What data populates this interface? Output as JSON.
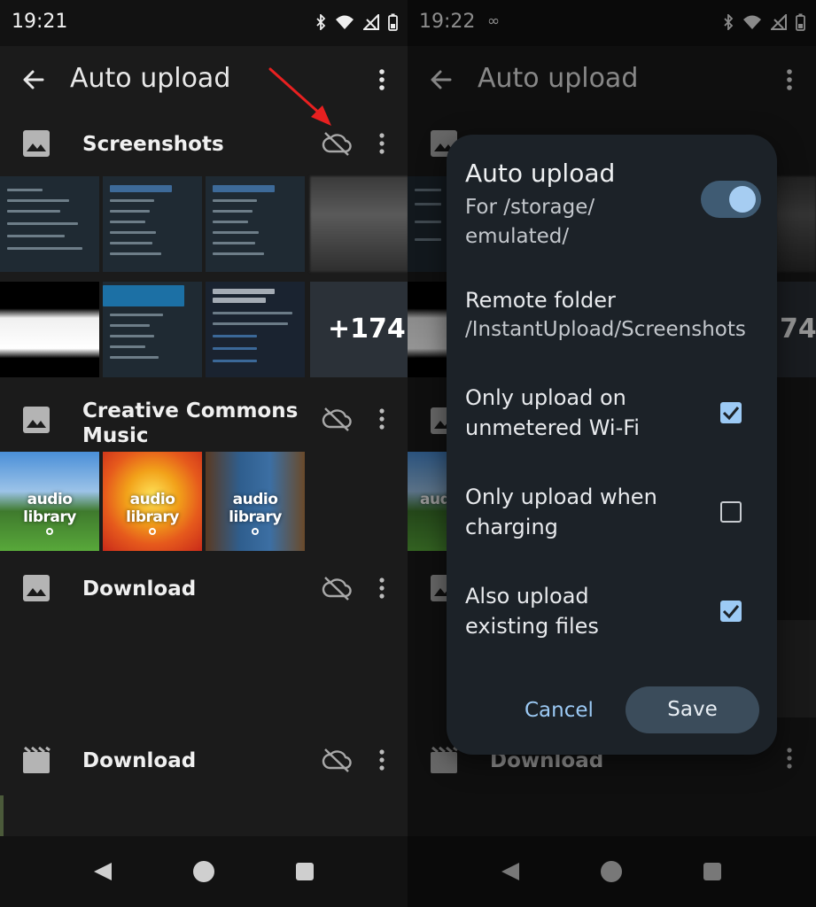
{
  "left": {
    "status_time": "19:21",
    "app_title": "Auto upload",
    "folders": [
      {
        "name": "Screenshots",
        "more_count": "+174"
      },
      {
        "name": "Creative Commons Music",
        "audio_labels": [
          "audio library",
          "audio library",
          "audio library"
        ]
      },
      {
        "name": "Download"
      },
      {
        "name": "Download"
      }
    ]
  },
  "right": {
    "status_time": "19:22",
    "status_extra": "∞",
    "app_title": "Auto upload",
    "bg_more": "74",
    "bg_folder_name": "Download",
    "bg_audio_label": "audi",
    "dialog": {
      "title": "Auto upload",
      "subtitle": "For /storage/ emulated/",
      "toggle_on": true,
      "remote_folder_label": "Remote folder",
      "remote_folder_value": "/InstantUpload/Screenshots",
      "options": [
        {
          "label": "Only upload on unmetered Wi-Fi",
          "checked": true
        },
        {
          "label": "Only upload when charging",
          "checked": false
        },
        {
          "label": "Also upload existing files",
          "checked": true
        }
      ],
      "cancel_label": "Cancel",
      "save_label": "Save"
    }
  },
  "colors": {
    "accent": "#9ccaf5",
    "arrow": "#e82020",
    "background": "#1b1b1b",
    "dialog": "#1c2228"
  }
}
